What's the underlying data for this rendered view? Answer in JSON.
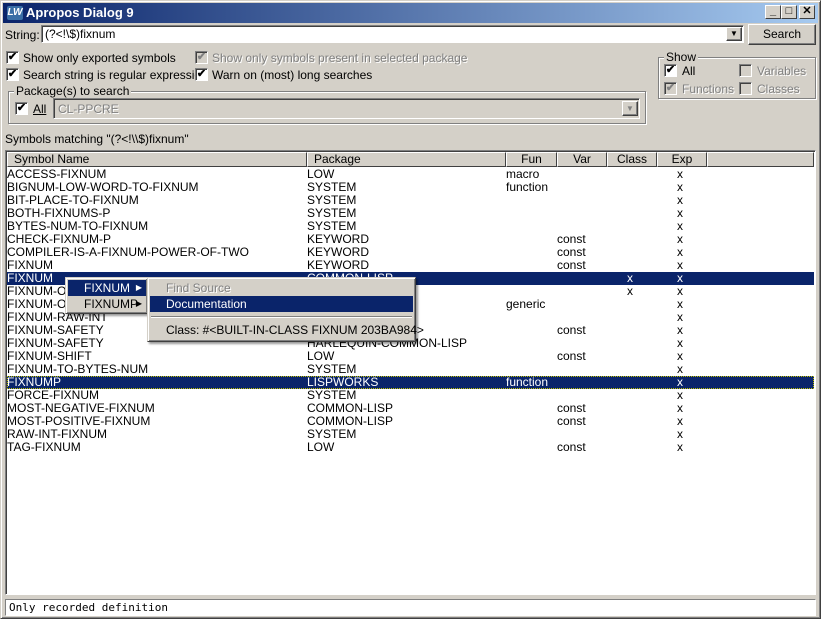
{
  "window": {
    "title": "Apropos Dialog 9",
    "logo": "LW",
    "minimize": "_",
    "maximize": "□",
    "close": "✕"
  },
  "search": {
    "label": "String:",
    "value": "(?<!\\$)fixnum",
    "button": "Search"
  },
  "options": {
    "exported": {
      "label": "Show only exported symbols",
      "checked": true
    },
    "regex": {
      "label": "Search string is regular expression",
      "checked": true
    },
    "present": {
      "label": "Show only symbols present in selected package",
      "checked": true,
      "disabled": true
    },
    "warn": {
      "label": "Warn on (most) long searches",
      "checked": true
    }
  },
  "packages": {
    "label": "Package(s) to search",
    "all_label": "All",
    "all_checked": true,
    "selected": "CL-PPCRE"
  },
  "show": {
    "label": "Show",
    "all": "All",
    "functions": "Functions",
    "variables": "Variables",
    "classes": "Classes",
    "all_checked": true,
    "functions_checked": true,
    "variables_checked": false,
    "classes_checked": false
  },
  "matching_label": "Symbols matching \"(?<!\\\\$)fixnum\"",
  "columns": [
    "Symbol Name",
    "Package",
    "Fun",
    "Var",
    "Class",
    "Exp"
  ],
  "rows": [
    {
      "name": "ACCESS-FIXNUM",
      "pkg": "LOW",
      "fun": "macro",
      "var": "",
      "cls": "",
      "exp": "x"
    },
    {
      "name": "BIGNUM-LOW-WORD-TO-FIXNUM",
      "pkg": "SYSTEM",
      "fun": "function",
      "var": "",
      "cls": "",
      "exp": "x"
    },
    {
      "name": "BIT-PLACE-TO-FIXNUM",
      "pkg": "SYSTEM",
      "fun": "",
      "var": "",
      "cls": "",
      "exp": "x"
    },
    {
      "name": "BOTH-FIXNUMS-P",
      "pkg": "SYSTEM",
      "fun": "",
      "var": "",
      "cls": "",
      "exp": "x"
    },
    {
      "name": "BYTES-NUM-TO-FIXNUM",
      "pkg": "SYSTEM",
      "fun": "",
      "var": "",
      "cls": "",
      "exp": "x"
    },
    {
      "name": "CHECK-FIXNUM-P",
      "pkg": "KEYWORD",
      "fun": "",
      "var": "const",
      "cls": "",
      "exp": "x"
    },
    {
      "name": "COMPILER-IS-A-FIXNUM-POWER-OF-TWO",
      "pkg": "KEYWORD",
      "fun": "",
      "var": "const",
      "cls": "",
      "exp": "x"
    },
    {
      "name": "FIXNUM",
      "pkg": "KEYWORD",
      "fun": "",
      "var": "const",
      "cls": "",
      "exp": "x"
    },
    {
      "name": "FIXNUM",
      "pkg": "COMMON-LISP",
      "fun": "",
      "var": "",
      "cls": "x",
      "exp": "x",
      "selected": true
    },
    {
      "name": "FIXNUM-OV",
      "pkg": "",
      "fun": "",
      "var": "",
      "cls": "x",
      "exp": "x"
    },
    {
      "name": "FIXNUM-OV",
      "pkg": "",
      "fun": "generic",
      "var": "",
      "cls": "",
      "exp": "x"
    },
    {
      "name": "FIXNUM-RAW-INT",
      "pkg": "",
      "fun": "",
      "var": "",
      "cls": "",
      "exp": "x"
    },
    {
      "name": "FIXNUM-SAFETY",
      "pkg": "",
      "fun": "",
      "var": "const",
      "cls": "",
      "exp": "x"
    },
    {
      "name": "FIXNUM-SAFETY",
      "pkg": "HARLEQUIN-COMMON-LISP",
      "fun": "",
      "var": "",
      "cls": "",
      "exp": "x"
    },
    {
      "name": "FIXNUM-SHIFT",
      "pkg": "LOW",
      "fun": "",
      "var": "const",
      "cls": "",
      "exp": "x"
    },
    {
      "name": "FIXNUM-TO-BYTES-NUM",
      "pkg": "SYSTEM",
      "fun": "",
      "var": "",
      "cls": "",
      "exp": "x"
    },
    {
      "name": "FIXNUMP",
      "pkg": "LISPWORKS",
      "fun": "function",
      "var": "",
      "cls": "",
      "exp": "x",
      "selected": true,
      "focused": true
    },
    {
      "name": "FORCE-FIXNUM",
      "pkg": "SYSTEM",
      "fun": "",
      "var": "",
      "cls": "",
      "exp": "x"
    },
    {
      "name": "MOST-NEGATIVE-FIXNUM",
      "pkg": "COMMON-LISP",
      "fun": "",
      "var": "const",
      "cls": "",
      "exp": "x"
    },
    {
      "name": "MOST-POSITIVE-FIXNUM",
      "pkg": "COMMON-LISP",
      "fun": "",
      "var": "const",
      "cls": "",
      "exp": "x"
    },
    {
      "name": "RAW-INT-FIXNUM",
      "pkg": "SYSTEM",
      "fun": "",
      "var": "",
      "cls": "",
      "exp": "x"
    },
    {
      "name": "TAG-FIXNUM",
      "pkg": "LOW",
      "fun": "",
      "var": "const",
      "cls": "",
      "exp": "x"
    }
  ],
  "context_menu": {
    "items": [
      "FIXNUM",
      "FIXNUMP"
    ],
    "submenu": {
      "find_source": "Find Source",
      "documentation": "Documentation",
      "class_info": "Class: #<BUILT-IN-CLASS FIXNUM 203BA984>"
    }
  },
  "status": "Only recorded definition"
}
